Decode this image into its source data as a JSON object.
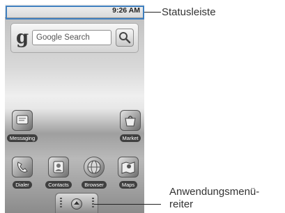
{
  "status_bar": {
    "time": "9:26 AM"
  },
  "search_widget": {
    "logo": "g",
    "placeholder": "Google Search",
    "button_icon": "search-icon"
  },
  "home_apps": [
    {
      "label": "Messaging",
      "icon": "messaging-icon"
    },
    {
      "label": "Market",
      "icon": "market-icon"
    },
    {
      "label": "Dialer",
      "icon": "dialer-icon"
    },
    {
      "label": "Contacts",
      "icon": "contacts-icon"
    },
    {
      "label": "Browser",
      "icon": "browser-icon"
    },
    {
      "label": "Maps",
      "icon": "maps-icon"
    }
  ],
  "app_drawer": {
    "icon": "app-drawer-icon"
  },
  "callouts": {
    "status_bar": "Statusleiste",
    "app_tab_line1": "Anwendungsmenü-",
    "app_tab_line2": "reiter"
  }
}
